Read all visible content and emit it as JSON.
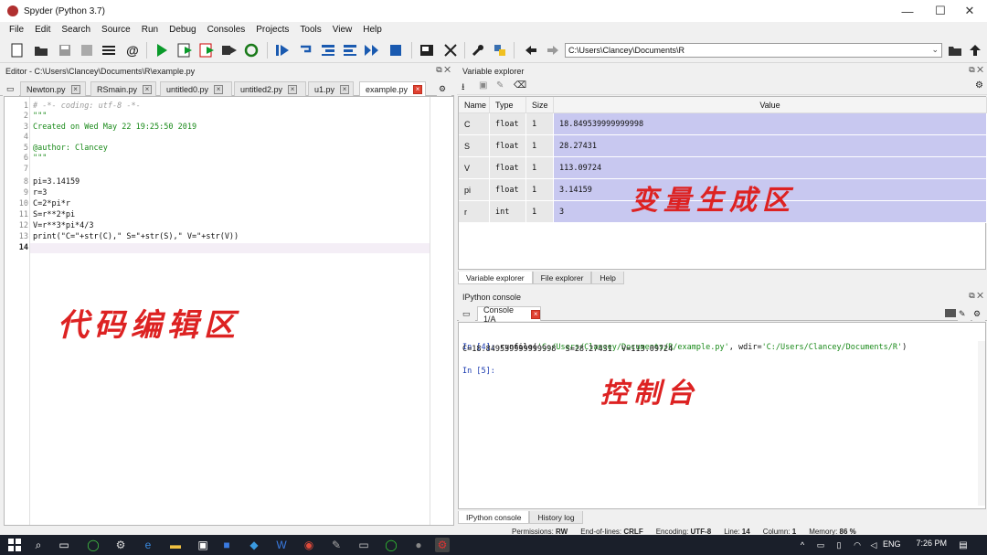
{
  "window": {
    "title": "Spyder (Python 3.7)",
    "minimize": "—",
    "maximize": "☐",
    "close": "✕"
  },
  "menu": [
    "File",
    "Edit",
    "Search",
    "Source",
    "Run",
    "Debug",
    "Consoles",
    "Projects",
    "Tools",
    "View",
    "Help"
  ],
  "toolbar": {
    "path": "C:\\Users\\Clancey\\Documents\\R",
    "path_dropdown": "⌄"
  },
  "editor": {
    "header": "Editor - C:\\Users\\Clancey\\Documents\\R\\example.py",
    "tabs": [
      "Newton.py",
      "RSmain.py",
      "untitled0.py",
      "untitled2.py",
      "u1.py",
      "example.py"
    ],
    "active_tab": "example.py",
    "line_numbers": [
      "1",
      "2",
      "3",
      "4",
      "5",
      "6",
      "7",
      "8",
      "9",
      "10",
      "11",
      "12",
      "13",
      "14"
    ],
    "lines": [
      "# -*- coding: utf-8 -*-",
      "\"\"\"",
      "Created on Wed May 22 19:25:50 2019",
      "",
      "@author: Clancey",
      "\"\"\"",
      "",
      "pi=3.14159",
      "r=3",
      "C=2*pi*r",
      "S=r**2*pi",
      "V=r**3*pi*4/3",
      "print(\"C=\"+str(C),\" S=\"+str(S),\" V=\"+str(V))",
      ""
    ],
    "annotation": "代码编辑区"
  },
  "variable_explorer": {
    "header": "Variable explorer",
    "columns": [
      "Name",
      "Type",
      "Size",
      "Value"
    ],
    "rows": [
      {
        "name": "C",
        "type": "float",
        "size": "1",
        "value": "18.849539999999998"
      },
      {
        "name": "S",
        "type": "float",
        "size": "1",
        "value": "28.27431"
      },
      {
        "name": "V",
        "type": "float",
        "size": "1",
        "value": "113.09724"
      },
      {
        "name": "pi",
        "type": "float",
        "size": "1",
        "value": "3.14159"
      },
      {
        "name": "r",
        "type": "int",
        "size": "1",
        "value": "3"
      }
    ],
    "bottom_tabs": [
      "Variable explorer",
      "File explorer",
      "Help"
    ],
    "annotation": "变量生成区"
  },
  "console": {
    "header": "IPython console",
    "tab": "Console 1/A",
    "in4_prompt": "In [4]: ",
    "in4_cmd": "runfile(",
    "in4_arg1": "'C:/Users/Clancey/Documents/R/example.py'",
    "in4_mid": ", wdir=",
    "in4_arg2": "'C:/Users/Clancey/Documents/R'",
    "in4_end": ")",
    "output": "C=18.849539999999998  S=28.27431  V=113.09724",
    "in5_prompt": "In [5]:",
    "bottom_tabs": [
      "IPython console",
      "History log"
    ],
    "annotation": "控制台"
  },
  "statusbar": {
    "permissions_label": "Permissions:",
    "permissions": "RW",
    "eol_label": "End-of-lines:",
    "eol": "CRLF",
    "encoding_label": "Encoding:",
    "encoding": "UTF-8",
    "line_label": "Line:",
    "line": "14",
    "column_label": "Column:",
    "column": "1",
    "memory_label": "Memory:",
    "memory": "86 %"
  },
  "taskbar": {
    "lang": "ENG",
    "time": "7:26 PM"
  },
  "colors": {
    "selected_row": "#c8c8f0",
    "string_green": "#1a8a1a",
    "comment_gray": "#999999",
    "annotation_red": "#dd2222"
  }
}
